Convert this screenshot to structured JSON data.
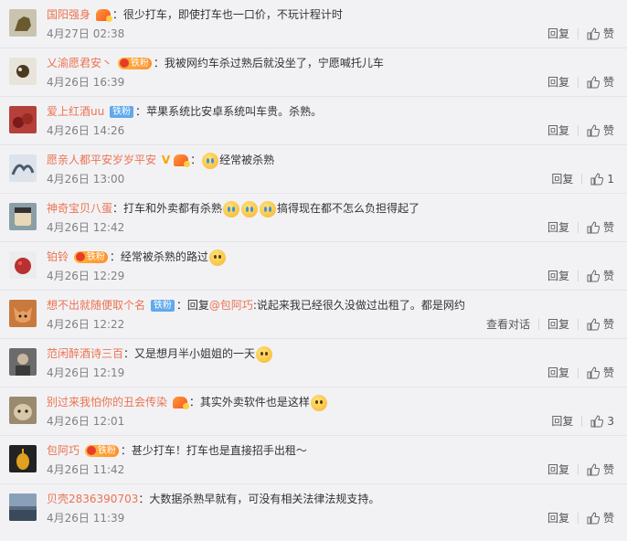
{
  "labels": {
    "reply": "回复",
    "like": "赞",
    "view_conversation": "查看对话",
    "colon": "："
  },
  "badges": {
    "fan": "铁粉"
  },
  "colors": {
    "username": "#eb7350",
    "fan_badge_blue": "#60a9ec",
    "fan_badge_gold": "#ff9b3c",
    "timestamp": "#808080",
    "background": "#f2f2f5"
  },
  "comments": [
    {
      "user": "国阳强身",
      "badge": "vip",
      "text": "很少打车，即使打车也一口价，不玩计程计时",
      "time": "4月27日 02:38",
      "likes": "",
      "avatar_color": "#c9c4b0"
    },
    {
      "user": "乂渝愿君安丶",
      "badge": "vip-fan",
      "text": "我被网约车杀过熟后就没坐了，宁愿喊托儿车",
      "time": "4月26日 16:39",
      "likes": "",
      "avatar_color": "#e9e4da"
    },
    {
      "user": "爱上红酒uu",
      "badge": "fan-blue",
      "text": "苹果系统比安卓系统叫车贵。杀熟。",
      "time": "4月26日 14:26",
      "likes": "",
      "avatar_color": "#b5403a"
    },
    {
      "user": "愿亲人都平安岁岁平安",
      "badge": "v-vip",
      "text": "经常被杀熟",
      "emoji_before": "cry",
      "time": "4月26日 13:00",
      "likes": "1",
      "avatar_color": "#7a8aa0"
    },
    {
      "user": "神奇宝贝八蛋",
      "badge": "none",
      "text_a": "打车和外卖都有杀熟",
      "text_b": "搞得现在都不怎么负担得起了",
      "emoji_mid": 3,
      "time": "4月26日 12:42",
      "likes": "",
      "avatar_color": "#8a9fa6"
    },
    {
      "user": "铂铃",
      "badge": "vip-fan",
      "text": "经常被杀熟的路过",
      "emoji_after": "smile",
      "time": "4月26日 12:29",
      "likes": "",
      "avatar_color": "#b83030"
    },
    {
      "user": "想不出就随便取个名",
      "badge": "fan-blue",
      "reply_prefix": "回复",
      "mention": "@包阿巧",
      "text": ":说起来我已经很久没做过出租了。都是网约",
      "time": "4月26日 12:22",
      "likes": "",
      "has_conversation": true,
      "avatar_color": "#c87a3e"
    },
    {
      "user": "范闲醉酒诗三百",
      "badge": "none",
      "text": "又是想月半小姐姐的一天",
      "emoji_after": "kiss",
      "time": "4月26日 12:19",
      "likes": "",
      "avatar_color": "#6b6b6b"
    },
    {
      "user": "别过来我怕你的丑会传染",
      "badge": "vip",
      "text": "其实外卖软件也是这样",
      "emoji_after": "smile",
      "time": "4月26日 12:01",
      "likes": "3",
      "avatar_color": "#9a8a70"
    },
    {
      "user": "包阿巧",
      "badge": "vip-fan",
      "text": "甚少打车！打车也是直接招手出租～",
      "time": "4月26日 11:42",
      "likes": "",
      "avatar_color": "#222222"
    },
    {
      "user": "贝壳2836390703",
      "badge": "none",
      "text": "大数据杀熟早就有，可没有相关法律法规支持。",
      "time": "4月26日 11:39",
      "likes": "",
      "avatar_color": "#5a6a80"
    }
  ]
}
